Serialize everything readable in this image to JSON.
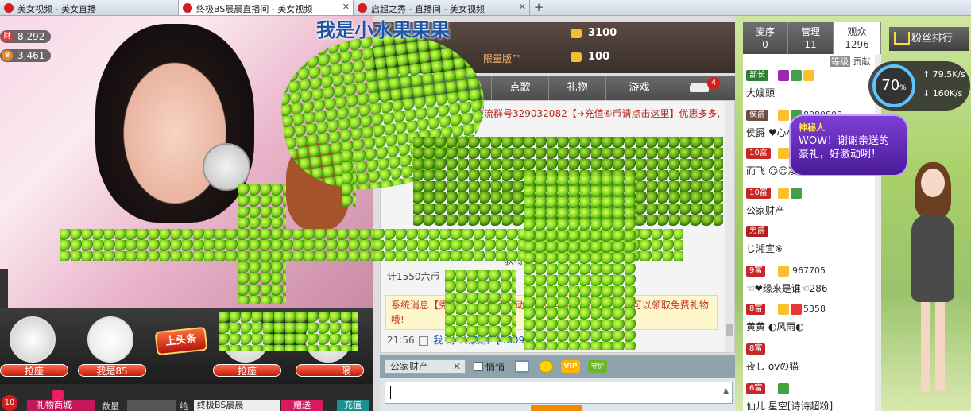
{
  "browser": {
    "tabs": [
      {
        "label": "美女视频 - 美女直播"
      },
      {
        "label": "终极BS晨晨直播间 - 美女视频"
      },
      {
        "label": "启超之秀 - 直播间 - 美女视频"
      }
    ]
  },
  "video": {
    "viewer_count": "8,292",
    "like_count": "3,461",
    "overlay_title": "我是小水果果果"
  },
  "seats": {
    "seat1_label": "抢座",
    "seat2_label": "我是85",
    "seat3_label": "抢座",
    "seat4_label": "限",
    "headline_badge": "上头条"
  },
  "giftbar": {
    "badge": "10",
    "store_label": "礼物商城",
    "qty_label": "数量",
    "give_label": "给",
    "target_value": "终极BS晨晨",
    "send_label": "赠送",
    "recharge_label": "充值"
  },
  "header": {
    "coins_top": "3100",
    "edition": "限量版™",
    "coins_bottom": "100"
  },
  "tabs": {
    "song": "点歌",
    "gift": "礼物",
    "game": "游戏",
    "car_badge": "4"
  },
  "chat": {
    "notice1": "交流群号329032082【➜充值⑥币请点击这里】优惠多多,",
    "fragA": "获得花钱",
    "fragB": "计1550六币",
    "system": "系统消息【秀场】打扫房间互动抢座，可用于祝登陆 秀场可以领取免费礼物哦!",
    "line_time": "21:56",
    "line_me": "我",
    "line_to": "对",
    "line_target": "公家财产[38092]"
  },
  "toolbar": {
    "recipient": "公家财产",
    "whisper": "悄悄",
    "vip": "VIP",
    "guard": "守护"
  },
  "right": {
    "tab1": {
      "label": "麦序",
      "count": "0"
    },
    "tab2": {
      "label": "管理",
      "count": "11"
    },
    "tab3": {
      "label": "观众",
      "count": "1296"
    },
    "fans_rank": "粉丝排行",
    "contrib_tag": "等级",
    "contrib_label": "贡献",
    "speed_percent": "70",
    "speed_up": "79.5K/s",
    "speed_down": "160K/s",
    "bubble_title": "神秘人",
    "bubble_text": "WOW！谢谢亲送的豪礼，好激动咧！",
    "users": [
      {
        "rank": "部长",
        "extra": "",
        "name": "大嫂頭"
      },
      {
        "rank": "侯爵",
        "extra": "8080808",
        "name": "侯爵 ♥心小三♥"
      },
      {
        "rank": "10富",
        "extra": "",
        "name": "而飞 ☺☺凌子潮音读"
      },
      {
        "rank": "10富",
        "extra": "",
        "name": "公家财产"
      },
      {
        "rank": "男爵",
        "extra": "",
        "name": "じ湘宜※"
      },
      {
        "rank": "9富",
        "extra": "967705",
        "name": "☜❤缘来是谁☜286"
      },
      {
        "rank": "8富",
        "extra": "5358",
        "name": "黄黄 ◐风雨◐"
      },
      {
        "rank": "8富",
        "extra": "",
        "name": "夜し ovの猫"
      },
      {
        "rank": "6富",
        "extra": "",
        "name": "仙儿 星空[诗诗超粉]"
      }
    ]
  },
  "colors": {
    "accent_red": "#d21e1e",
    "apple_green": "#7ed321",
    "right_bg": "#a9d06a"
  }
}
